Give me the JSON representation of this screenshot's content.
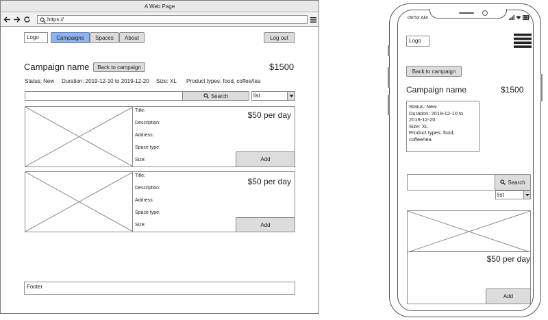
{
  "window": {
    "title": "A Web Page",
    "url": "https://"
  },
  "desktop": {
    "logo": "Logo",
    "nav": {
      "campaigns": "Campaigns",
      "spaces": "Spaces",
      "about": "About"
    },
    "logout": "Log out",
    "campaign_name": "Campaign name",
    "back_button": "Back to campaign",
    "price": "$1500",
    "status": "Status: New",
    "duration": "Duration: 2019-12-10 to 2019-12-20",
    "size": "Size: XL",
    "product_types": "Product types: food, coffee/tea",
    "search_button": "Search",
    "view_select": "list",
    "cards": [
      {
        "title": "Title:",
        "description": "Description:",
        "address": "Address:",
        "space_type": "Space type:",
        "size": "Size:",
        "price": "$50 per day",
        "add": "Add"
      },
      {
        "title": "Title:",
        "description": "Description:",
        "address": "Address:",
        "space_type": "Space type:",
        "size": "Size:",
        "price": "$50 per day",
        "add": "Add"
      }
    ],
    "footer": "Footer"
  },
  "mobile": {
    "time": "09:52 AM",
    "logo": "Logo",
    "back_button": "Back to campaign",
    "campaign_name": "Campaign name",
    "price": "$1500",
    "details": [
      "Status: New",
      "Duration: 2019-12-10 to",
      "2019-12-20",
      "Size: XL",
      "Product types: food,",
      "coffee/tea"
    ],
    "search_button": "Search",
    "view_select": "list",
    "card_price": "$50 per day",
    "add": "Add"
  }
}
